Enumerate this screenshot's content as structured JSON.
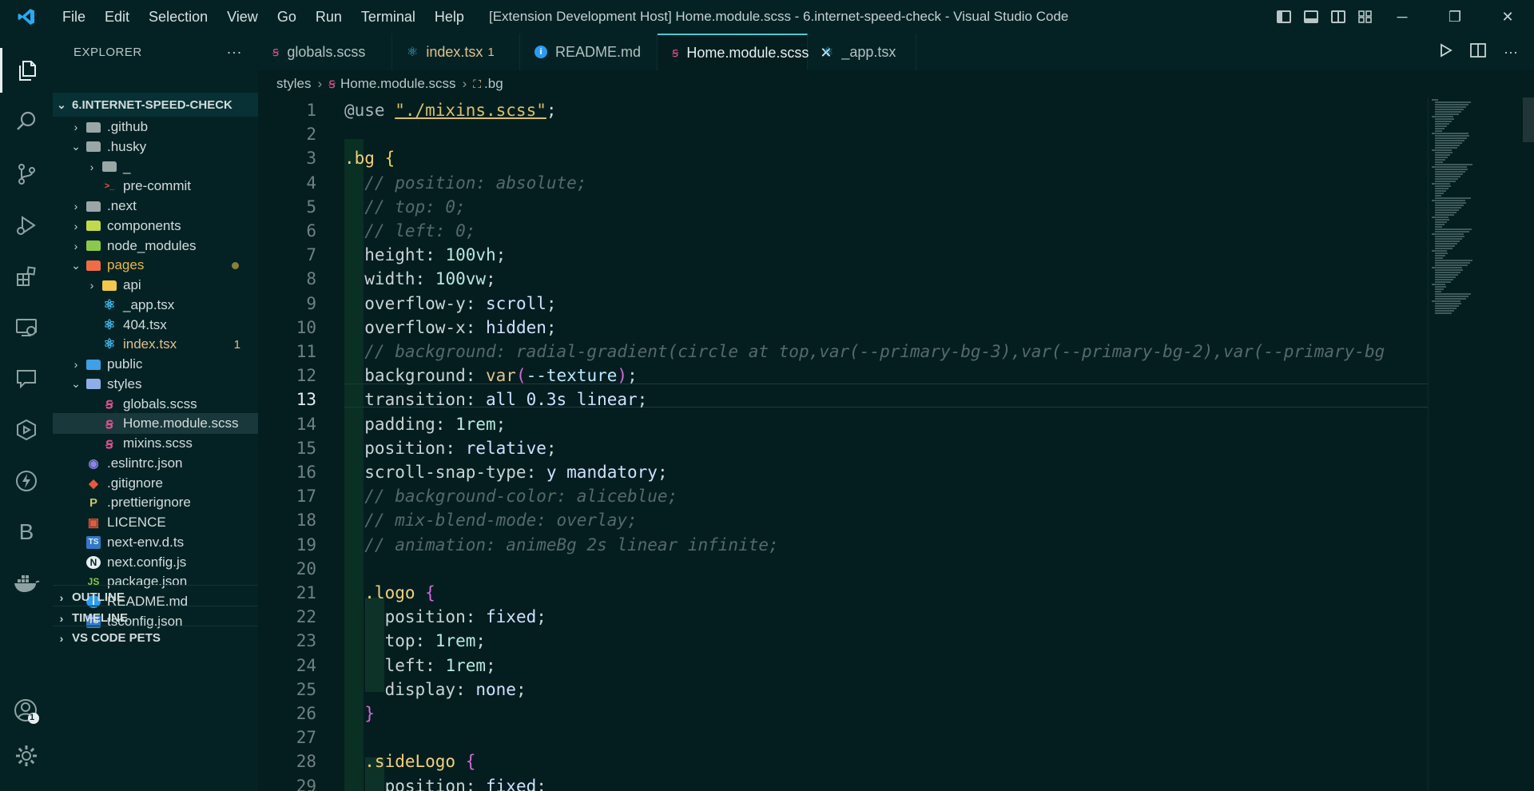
{
  "window": {
    "title": "[Extension Development Host] Home.module.scss - 6.internet-speed-check - Visual Studio Code",
    "menu": [
      "File",
      "Edit",
      "Selection",
      "View",
      "Go",
      "Run",
      "Terminal",
      "Help"
    ],
    "controls": {
      "minimize": "─",
      "restore": "❐",
      "close": "✕"
    }
  },
  "activity_bar": {
    "items": [
      "explorer-icon",
      "search-icon",
      "source-control-icon",
      "run-debug-icon",
      "extensions-icon",
      "remote-explorer-icon",
      "comments-icon",
      "testing-icon",
      "thunder-icon"
    ],
    "b_label": "B",
    "account_badge": "1"
  },
  "sidebar": {
    "header": "EXPLORER",
    "more": "···",
    "root": "6.INTERNET-SPEED-CHECK",
    "tree": [
      {
        "label": ".github",
        "kind": "folder",
        "chevron": "›",
        "depth": 1
      },
      {
        "label": ".husky",
        "kind": "folder",
        "chevron": "⌄",
        "depth": 1
      },
      {
        "label": "_",
        "kind": "folder",
        "chevron": "›",
        "depth": 2
      },
      {
        "label": "pre-commit",
        "kind": "file",
        "icon": "terminal",
        "depth": 2
      },
      {
        "label": ".next",
        "kind": "folder",
        "chevron": "›",
        "depth": 1
      },
      {
        "label": "components",
        "kind": "folder",
        "chevron": "›",
        "depth": 1
      },
      {
        "label": "node_modules",
        "kind": "folder",
        "chevron": "›",
        "depth": 1
      },
      {
        "label": "pages",
        "kind": "folder",
        "chevron": "⌄",
        "depth": 1,
        "color": "#e8b84a"
      },
      {
        "label": "api",
        "kind": "folder",
        "chevron": "›",
        "depth": 2
      },
      {
        "label": "_app.tsx",
        "kind": "file",
        "icon": "react",
        "depth": 2
      },
      {
        "label": "404.tsx",
        "kind": "file",
        "icon": "react",
        "depth": 2
      },
      {
        "label": "index.tsx",
        "kind": "file",
        "icon": "react",
        "depth": 2,
        "color": "#e2c08d",
        "badge": "1"
      },
      {
        "label": "public",
        "kind": "folder",
        "chevron": "›",
        "depth": 1
      },
      {
        "label": "styles",
        "kind": "folder",
        "chevron": "⌄",
        "depth": 1
      },
      {
        "label": "globals.scss",
        "kind": "file",
        "icon": "sass",
        "depth": 2
      },
      {
        "label": "Home.module.scss",
        "kind": "file",
        "icon": "sass",
        "depth": 2,
        "selected": true
      },
      {
        "label": "mixins.scss",
        "kind": "file",
        "icon": "sass",
        "depth": 2
      },
      {
        "label": ".eslintrc.json",
        "kind": "file",
        "icon": "eslint",
        "depth": 1
      },
      {
        "label": ".gitignore",
        "kind": "file",
        "icon": "git",
        "depth": 1
      },
      {
        "label": ".prettierignore",
        "kind": "file",
        "icon": "prettier",
        "depth": 1
      },
      {
        "label": "LICENCE",
        "kind": "file",
        "icon": "license",
        "depth": 1
      },
      {
        "label": "next-env.d.ts",
        "kind": "file",
        "icon": "ts",
        "depth": 1
      },
      {
        "label": "next.config.js",
        "kind": "file",
        "icon": "next",
        "depth": 1
      },
      {
        "label": "package.json",
        "kind": "file",
        "icon": "node",
        "depth": 1
      },
      {
        "label": "README.md",
        "kind": "file",
        "icon": "info",
        "depth": 1
      },
      {
        "label": "tsconfig.json",
        "kind": "file",
        "icon": "ts",
        "depth": 1
      }
    ],
    "sections": [
      "OUTLINE",
      "TIMELINE",
      "VS CODE PETS"
    ]
  },
  "tabs": [
    {
      "label": "globals.scss",
      "icon": "sass"
    },
    {
      "label": "index.tsx",
      "icon": "react",
      "badge": "1",
      "modified_color": "#e2c08d"
    },
    {
      "label": "README.md",
      "icon": "info"
    },
    {
      "label": "Home.module.scss",
      "icon": "sass",
      "active": true
    },
    {
      "label": "_app.tsx",
      "icon": "react"
    }
  ],
  "breadcrumb": [
    "styles",
    "Home.module.scss",
    ".bg"
  ],
  "editor": {
    "current_line": 13,
    "lines": [
      {
        "n": "1",
        "t": [
          [
            "c-at",
            "@use "
          ],
          [
            "c-str",
            "\"./mixins.scss\""
          ],
          [
            "c-prop",
            ";"
          ]
        ]
      },
      {
        "n": "2",
        "t": []
      },
      {
        "n": "3",
        "t": [
          [
            "c-sel",
            ".bg "
          ],
          [
            "c-brace",
            "{"
          ]
        ]
      },
      {
        "n": "4",
        "t": [
          [
            "c-com",
            "  // position: absolute;"
          ]
        ]
      },
      {
        "n": "5",
        "t": [
          [
            "c-com",
            "  // top: 0;"
          ]
        ]
      },
      {
        "n": "6",
        "t": [
          [
            "c-com",
            "  // left: 0;"
          ]
        ]
      },
      {
        "n": "7",
        "t": [
          [
            "c-prop",
            "  height: "
          ],
          [
            "c-num",
            "100vh"
          ],
          [
            "c-prop",
            ";"
          ]
        ]
      },
      {
        "n": "8",
        "t": [
          [
            "c-prop",
            "  width: "
          ],
          [
            "c-num",
            "100vw"
          ],
          [
            "c-prop",
            ";"
          ]
        ]
      },
      {
        "n": "9",
        "t": [
          [
            "c-prop",
            "  overflow-y: "
          ],
          [
            "c-kw",
            "scroll"
          ],
          [
            "c-prop",
            ";"
          ]
        ]
      },
      {
        "n": "10",
        "t": [
          [
            "c-prop",
            "  overflow-x: "
          ],
          [
            "c-kw",
            "hidden"
          ],
          [
            "c-prop",
            ";"
          ]
        ]
      },
      {
        "n": "11",
        "t": [
          [
            "c-com",
            "  // background: radial-gradient(circle at top,var(--primary-bg-3),var(--primary-bg-2),var(--primary-bg"
          ]
        ]
      },
      {
        "n": "12",
        "t": [
          [
            "c-prop",
            "  background: "
          ],
          [
            "c-fn",
            "var"
          ],
          [
            "c-brace2",
            "("
          ],
          [
            "c-var",
            "--texture"
          ],
          [
            "c-brace2",
            ")"
          ],
          [
            "c-prop",
            ";"
          ]
        ]
      },
      {
        "n": "13",
        "t": [
          [
            "c-prop",
            "  transition: "
          ],
          [
            "c-kw",
            "all 0.3s linear"
          ],
          [
            "c-prop",
            ";"
          ]
        ]
      },
      {
        "n": "14",
        "t": [
          [
            "c-prop",
            "  padding: "
          ],
          [
            "c-num",
            "1rem"
          ],
          [
            "c-prop",
            ";"
          ]
        ]
      },
      {
        "n": "15",
        "t": [
          [
            "c-prop",
            "  position: "
          ],
          [
            "c-kw",
            "relative"
          ],
          [
            "c-prop",
            ";"
          ]
        ]
      },
      {
        "n": "16",
        "t": [
          [
            "c-prop",
            "  scroll-snap-type: "
          ],
          [
            "c-kw",
            "y mandatory"
          ],
          [
            "c-prop",
            ";"
          ]
        ]
      },
      {
        "n": "17",
        "t": [
          [
            "c-com",
            "  // background-color: aliceblue;"
          ]
        ]
      },
      {
        "n": "18",
        "t": [
          [
            "c-com",
            "  // mix-blend-mode: overlay;"
          ]
        ]
      },
      {
        "n": "19",
        "t": [
          [
            "c-com",
            "  // animation: animeBg 2s linear infinite;"
          ]
        ]
      },
      {
        "n": "20",
        "t": []
      },
      {
        "n": "21",
        "t": [
          [
            "c-sel",
            "  .logo "
          ],
          [
            "c-brace2",
            "{"
          ]
        ]
      },
      {
        "n": "22",
        "t": [
          [
            "c-prop",
            "    position: "
          ],
          [
            "c-kw",
            "fixed"
          ],
          [
            "c-prop",
            ";"
          ]
        ]
      },
      {
        "n": "23",
        "t": [
          [
            "c-prop",
            "    top: "
          ],
          [
            "c-num",
            "1rem"
          ],
          [
            "c-prop",
            ";"
          ]
        ]
      },
      {
        "n": "24",
        "t": [
          [
            "c-prop",
            "    left: "
          ],
          [
            "c-num",
            "1rem"
          ],
          [
            "c-prop",
            ";"
          ]
        ]
      },
      {
        "n": "25",
        "t": [
          [
            "c-prop",
            "    display: "
          ],
          [
            "c-kw",
            "none"
          ],
          [
            "c-prop",
            ";"
          ]
        ]
      },
      {
        "n": "26",
        "t": [
          [
            "c-brace2",
            "  }"
          ]
        ]
      },
      {
        "n": "27",
        "t": []
      },
      {
        "n": "28",
        "t": [
          [
            "c-sel",
            "  .sideLogo "
          ],
          [
            "c-brace2",
            "{"
          ]
        ]
      },
      {
        "n": "29",
        "t": [
          [
            "c-prop",
            "    position: "
          ],
          [
            "c-kw",
            "fixed"
          ],
          [
            "c-prop",
            ";"
          ]
        ]
      }
    ]
  }
}
